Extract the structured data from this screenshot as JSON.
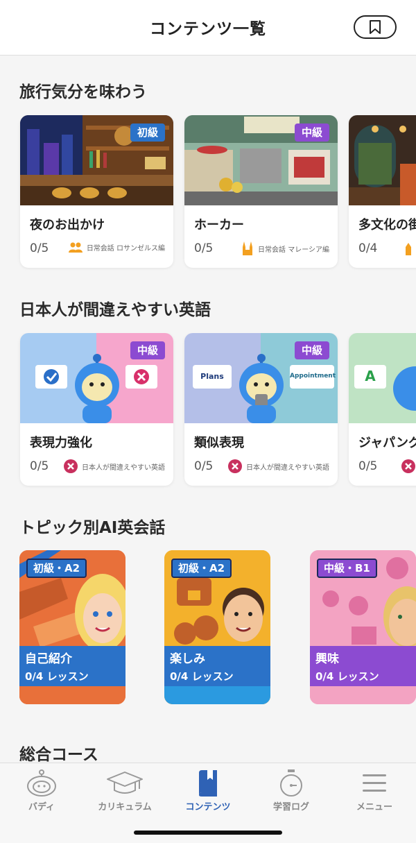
{
  "header": {
    "title": "コンテンツ一覧",
    "bookmark_icon": "bookmark-icon"
  },
  "sections": {
    "travel": {
      "title": "旅行気分を味わう",
      "cards": [
        {
          "name": "夜のお出かけ",
          "level": "初級",
          "progress": "0/5",
          "meta": "日常会話 ロサンゼルス編",
          "meta_icon": "people-icon"
        },
        {
          "name": "ホーカー",
          "level": "中級",
          "progress": "0/5",
          "meta": "日常会話 マレーシア編",
          "meta_icon": "temple-icon"
        },
        {
          "name": "多文化の街",
          "progress": "0/4",
          "meta_icon": "tower-icon"
        }
      ]
    },
    "mistakes": {
      "title": "日本人が間違えやすい英語",
      "cards": [
        {
          "name": "表現力強化",
          "level": "中級",
          "progress": "0/5",
          "meta": "日本人が間違えやすい英語",
          "bubble_left": "✓",
          "bubble_right": "✕"
        },
        {
          "name": "類似表現",
          "level": "中級",
          "progress": "0/5",
          "meta": "日本人が間違えやすい英語",
          "bubble_left": "Plans",
          "bubble_right": "Appointment"
        },
        {
          "name": "ジャパングリッシュ",
          "progress": "0/5",
          "bubble_left": "A"
        }
      ]
    },
    "topics": {
      "title": "トピック別AI英会話",
      "cards": [
        {
          "badge": "初級・A2",
          "name": "自己紹介",
          "progress": "0/4 レッスン"
        },
        {
          "badge": "初級・A2",
          "name": "楽しみ",
          "progress": "0/4 レッスン"
        },
        {
          "badge": "中級・B1",
          "name": "興味",
          "progress": "0/4 レッスン"
        }
      ]
    },
    "courses": {
      "title": "総合コース"
    }
  },
  "nav": {
    "items": [
      {
        "label": "バディ",
        "icon": "buddy-icon"
      },
      {
        "label": "カリキュラム",
        "icon": "graduation-cap-icon"
      },
      {
        "label": "コンテンツ",
        "icon": "book-icon",
        "active": true
      },
      {
        "label": "学習ログ",
        "icon": "stopwatch-icon"
      },
      {
        "label": "メニュー",
        "icon": "menu-icon"
      }
    ]
  },
  "colors": {
    "accent": "#2f62b5",
    "level_blue": "#2b72c8",
    "level_purple": "#8c4bd1"
  }
}
